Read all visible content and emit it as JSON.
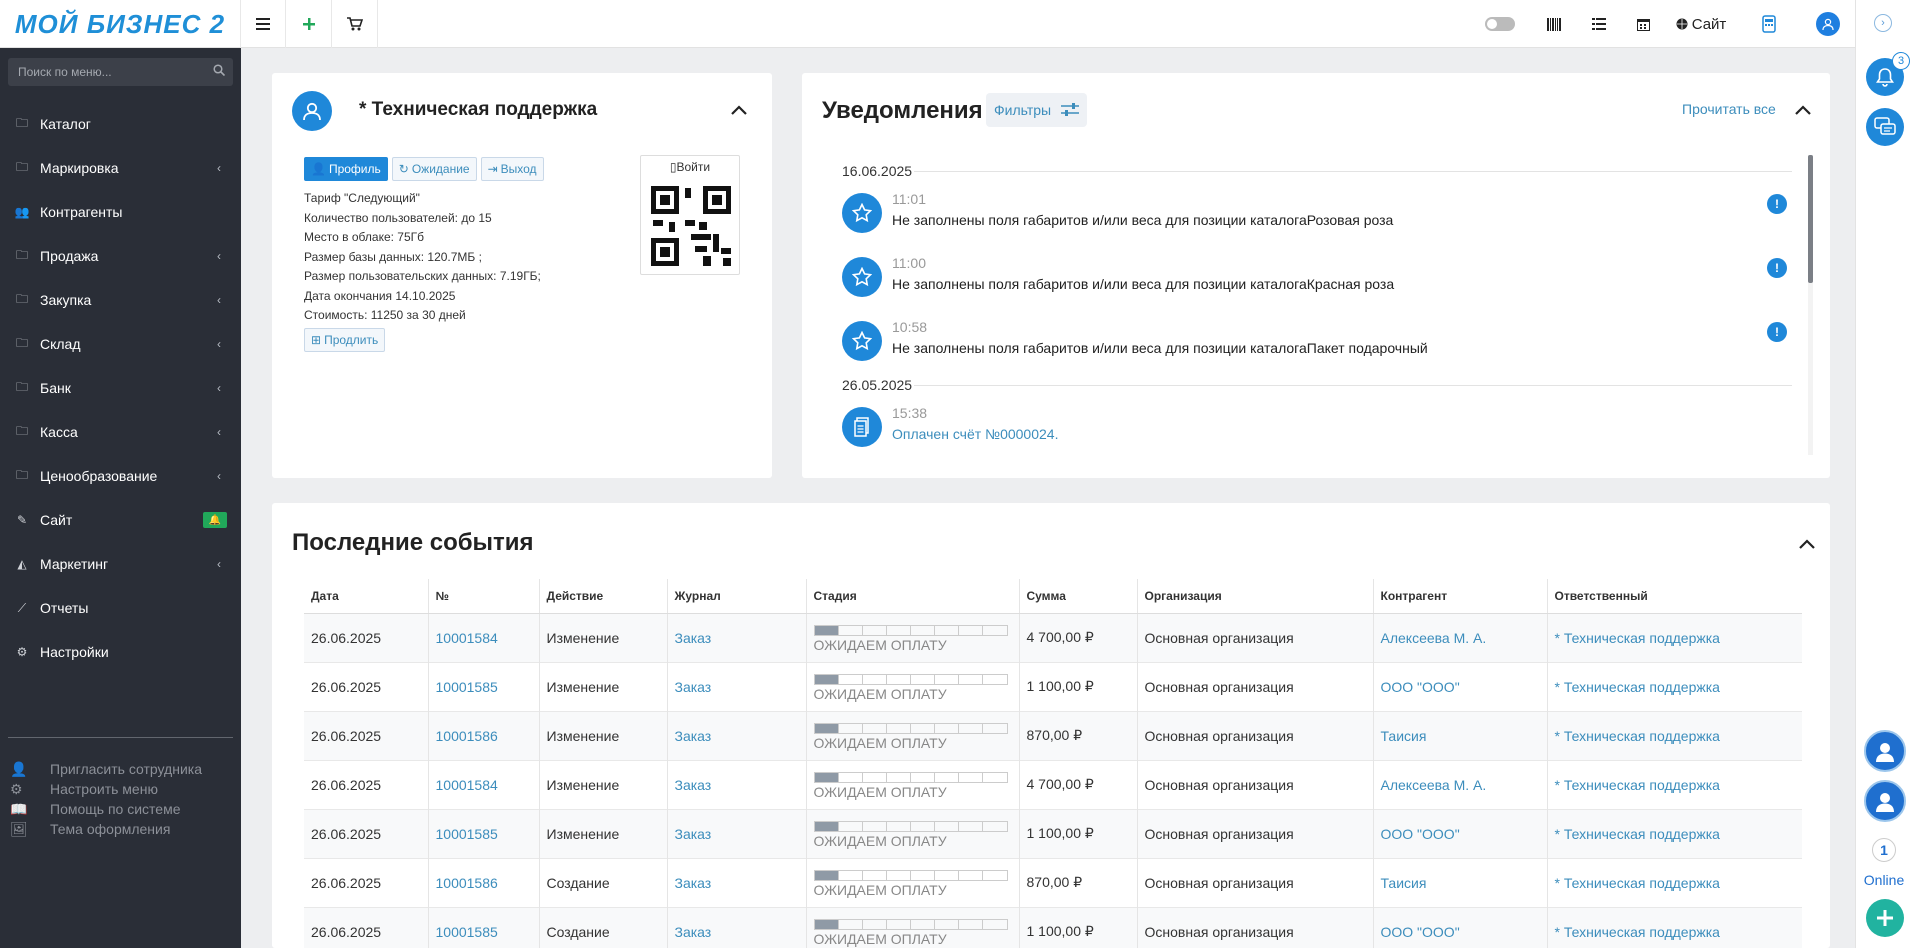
{
  "logo": {
    "text": "МОЙ БИЗНЕС 2"
  },
  "topbar": {
    "site_label": "Сайт"
  },
  "sidebar": {
    "search_placeholder": "Поиск по меню...",
    "items": [
      {
        "label": "Каталог",
        "icon": "folder-icon",
        "has_children": false
      },
      {
        "label": "Маркировка",
        "icon": "folder-icon",
        "has_children": true
      },
      {
        "label": "Контрагенты",
        "icon": "users-icon",
        "has_children": false
      },
      {
        "label": "Продажа",
        "icon": "folder-icon",
        "has_children": true
      },
      {
        "label": "Закупка",
        "icon": "folder-icon",
        "has_children": true
      },
      {
        "label": "Склад",
        "icon": "folder-icon",
        "has_children": true
      },
      {
        "label": "Банк",
        "icon": "folder-icon",
        "has_children": true
      },
      {
        "label": "Касса",
        "icon": "folder-icon",
        "has_children": true
      },
      {
        "label": "Ценообразование",
        "icon": "folder-icon",
        "has_children": true
      },
      {
        "label": "Сайт",
        "icon": "magic-wand-icon",
        "has_children": false
      },
      {
        "label": "Маркетинг",
        "icon": "area-chart-icon",
        "has_children": true
      },
      {
        "label": "Отчеты",
        "icon": "line-chart-icon",
        "has_children": false
      },
      {
        "label": "Настройки",
        "icon": "gear-icon",
        "has_children": false
      }
    ],
    "extra": [
      {
        "label": "Пригласить сотрудника",
        "icon": "user-plus-icon"
      },
      {
        "label": "Настроить меню",
        "icon": "gears-icon"
      },
      {
        "label": "Помощь по системе",
        "icon": "book-icon"
      },
      {
        "label": "Тема оформления",
        "icon": "image-icon"
      }
    ]
  },
  "support": {
    "title": "* Техническая поддержка",
    "buttons": {
      "profile": "Профиль",
      "waiting": "Ожидание",
      "exit": "Выход"
    },
    "login": "Войти",
    "info": [
      "Тариф \"Следующий\"",
      "Количество пользователей: до 15",
      "Место в облаке: 75Гб",
      "Размер базы данных: 120.7МБ ;",
      "Размер пользовательских данных: 7.19ГБ;",
      "Дата окончания 14.10.2025",
      "Стоимость: 11250 за 30 дней"
    ],
    "prolong": "Продлить"
  },
  "notifications": {
    "title": "Уведомления",
    "filters": "Фильтры",
    "read_all": "Прочитать все",
    "dates": [
      "16.06.2025",
      "26.05.2025"
    ],
    "items": [
      {
        "time": "11:01",
        "text": "Не заполнены поля габаритов и/или веса для позиции каталогаРозовая роза"
      },
      {
        "time": "11:00",
        "text": "Не заполнены поля габаритов и/или веса для позиции каталогаКрасная роза"
      },
      {
        "time": "10:58",
        "text": "Не заполнены поля габаритов и/или веса для позиции каталогаПакет подарочный"
      },
      {
        "time": "15:38",
        "text": "Оплачен счёт №0000024."
      }
    ]
  },
  "events": {
    "title": "Последние события",
    "columns": [
      "Дата",
      "№",
      "Действие",
      "Журнал",
      "Стадия",
      "Сумма",
      "Организация",
      "Контрагент",
      "Ответственный"
    ],
    "rows": [
      [
        "26.06.2025",
        "10001584",
        "Изменение",
        "Заказ",
        "ОЖИДАЕМ ОПЛАТУ",
        "4 700,00 ₽",
        "Основная организация",
        "Алексеева М. А.",
        "* Техническая поддержка"
      ],
      [
        "26.06.2025",
        "10001585",
        "Изменение",
        "Заказ",
        "ОЖИДАЕМ ОПЛАТУ",
        "1 100,00 ₽",
        "Основная организация",
        "ООО \"ООО\"",
        "* Техническая поддержка"
      ],
      [
        "26.06.2025",
        "10001586",
        "Изменение",
        "Заказ",
        "ОЖИДАЕМ ОПЛАТУ",
        "870,00 ₽",
        "Основная организация",
        "Таисия",
        "* Техническая поддержка"
      ],
      [
        "26.06.2025",
        "10001584",
        "Изменение",
        "Заказ",
        "ОЖИДАЕМ ОПЛАТУ",
        "4 700,00 ₽",
        "Основная организация",
        "Алексеева М. А.",
        "* Техническая поддержка"
      ],
      [
        "26.06.2025",
        "10001585",
        "Изменение",
        "Заказ",
        "ОЖИДАЕМ ОПЛАТУ",
        "1 100,00 ₽",
        "Основная организация",
        "ООО \"ООО\"",
        "* Техническая поддержка"
      ],
      [
        "26.06.2025",
        "10001586",
        "Создание",
        "Заказ",
        "ОЖИДАЕМ ОПЛАТУ",
        "870,00 ₽",
        "Основная организация",
        "Таисия",
        "* Техническая поддержка"
      ],
      [
        "26.06.2025",
        "10001585",
        "Создание",
        "Заказ",
        "ОЖИДАЕМ ОПЛАТУ",
        "1 100,00 ₽",
        "Основная организация",
        "ООО \"ООО\"",
        "* Техническая поддержка"
      ]
    ],
    "stage_progress": "1/8"
  },
  "rightstrip": {
    "notif_count": "3",
    "online_count": "1",
    "online_label": "Online",
    "account_label": "My account"
  },
  "colors": {
    "accent": "#1f88d9",
    "sidebar_bg": "#2a2e37",
    "link": "#3c8dbc"
  }
}
